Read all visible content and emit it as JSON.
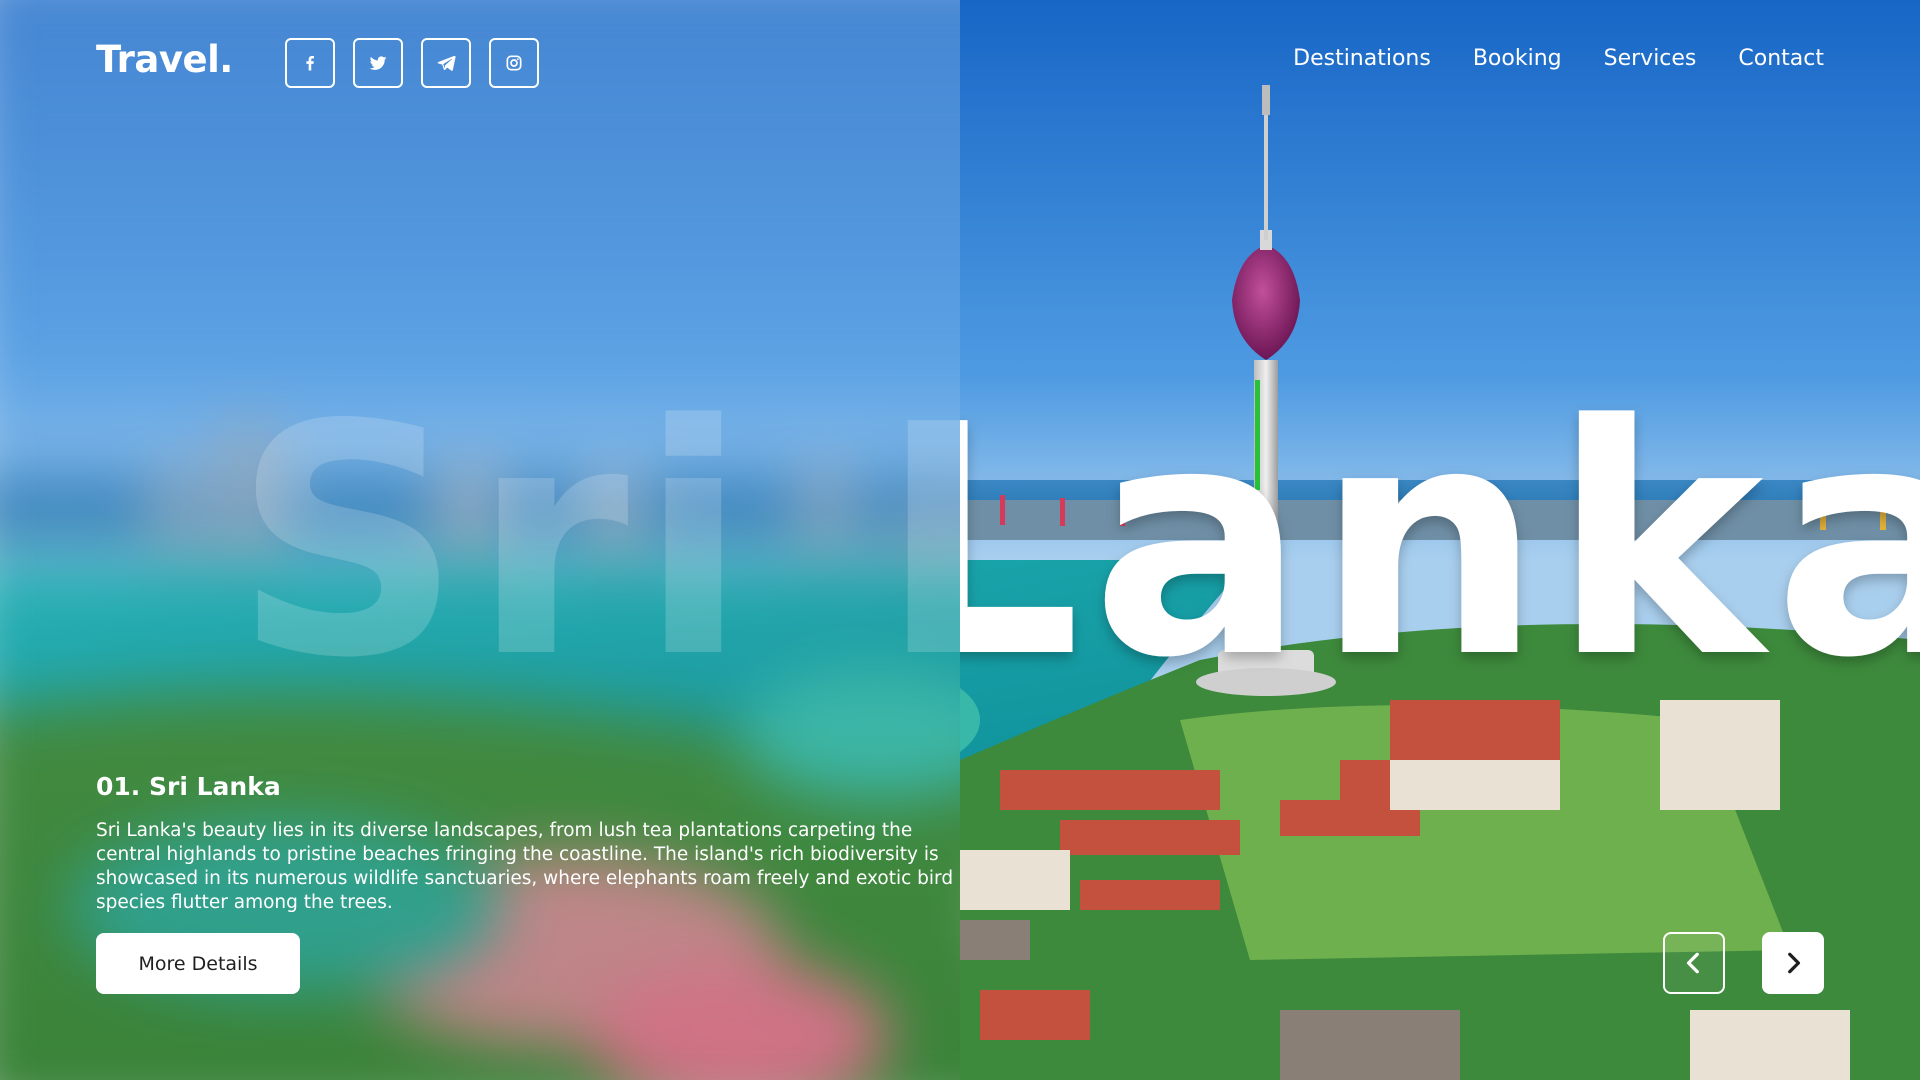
{
  "brand": {
    "logo": "Travel."
  },
  "socials": [
    {
      "icon": "facebook-icon",
      "glyph": "f"
    },
    {
      "icon": "twitter-icon"
    },
    {
      "icon": "telegram-icon"
    },
    {
      "icon": "instagram-icon"
    }
  ],
  "nav": {
    "items": [
      "Destinations",
      "Booking",
      "Services",
      "Contact"
    ]
  },
  "hero": {
    "headline": "Sri Lanka",
    "slide_title": "01. Sri Lanka",
    "description": "Sri Lanka's beauty lies in its diverse landscapes, from lush tea plantations carpeting the central highlands to pristine beaches fringing the coastline. The island's rich biodiversity is showcased in its numerous wildlife sanctuaries, where elephants roam freely and exotic bird species flutter among the trees.",
    "cta_label": "More Details"
  },
  "slider": {
    "prev_icon": "chevron-left-icon",
    "next_icon": "chevron-right-icon"
  },
  "colors": {
    "sky_top": "#1f74c9",
    "sky_mid": "#5aa7e8",
    "sea": "#2bb6b3",
    "greenery": "#3f8e3a",
    "roof": "#c4503e",
    "tower_pink": "#8a1f6a",
    "text": "#ffffff",
    "button_text": "#1f1f1f"
  }
}
